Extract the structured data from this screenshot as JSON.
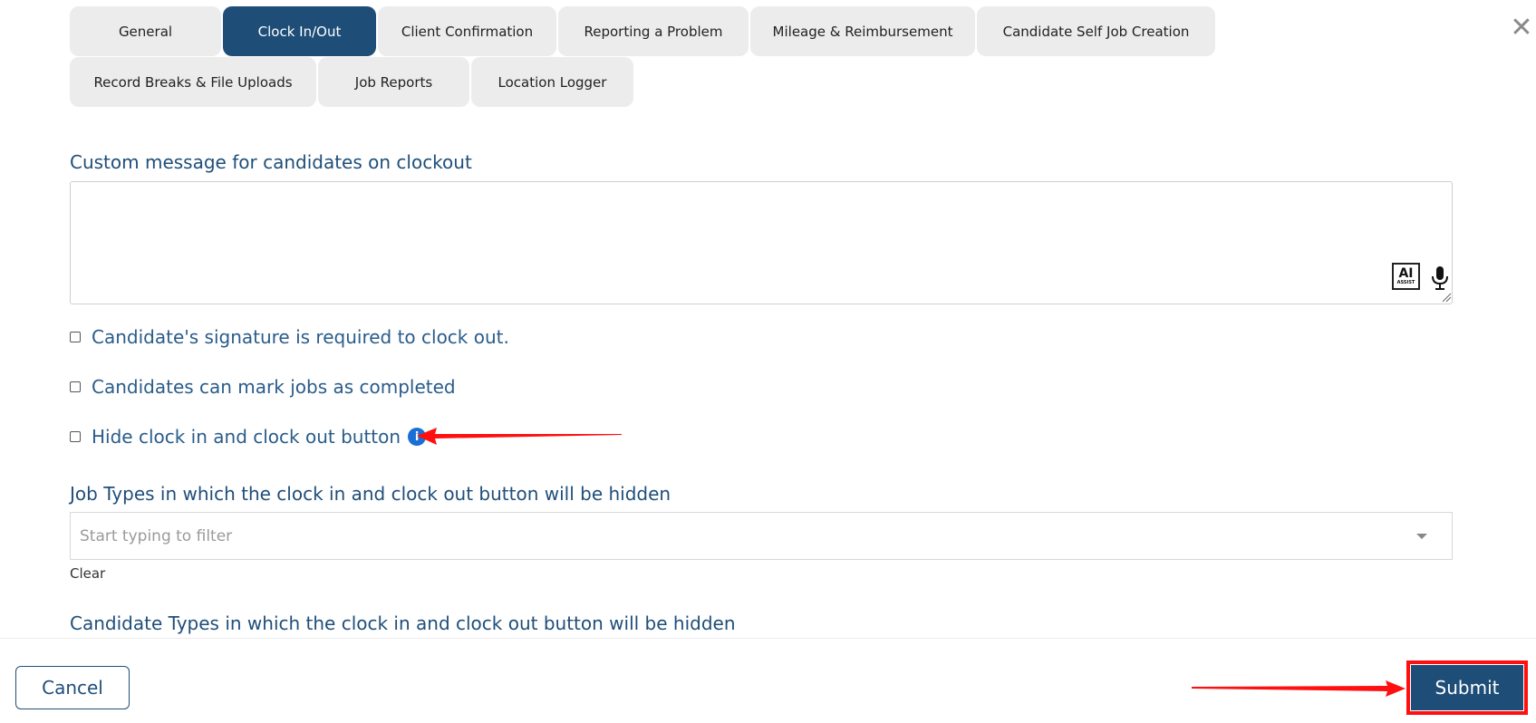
{
  "tabs": [
    {
      "label": "General",
      "active": false
    },
    {
      "label": "Clock In/Out",
      "active": true
    },
    {
      "label": "Client Confirmation",
      "active": false
    },
    {
      "label": "Reporting a Problem",
      "active": false
    },
    {
      "label": "Mileage & Reimbursement",
      "active": false
    },
    {
      "label": "Candidate Self Job Creation",
      "active": false
    },
    {
      "label": "Record Breaks & File Uploads",
      "active": false
    },
    {
      "label": "Job Reports",
      "active": false
    },
    {
      "label": "Location Logger",
      "active": false
    }
  ],
  "custom_message": {
    "label": "Custom message for candidates on clockout",
    "value": "",
    "ai_assist": {
      "big": "AI",
      "small": "ASSIST"
    }
  },
  "checkboxes": [
    {
      "label": "Candidate's signature is required to clock out.",
      "checked": false
    },
    {
      "label": "Candidates can mark jobs as completed",
      "checked": false
    },
    {
      "label": "Hide clock in and clock out button",
      "checked": false,
      "info_glyph": "i"
    }
  ],
  "job_types": {
    "label": "Job Types in which the clock in and clock out button will be hidden",
    "placeholder": "Start typing to filter",
    "clear_label": "Clear"
  },
  "candidate_types": {
    "label": "Candidate Types in which the clock in and clock out button will be hidden"
  },
  "footer": {
    "cancel_label": "Cancel",
    "submit_label": "Submit"
  },
  "colors": {
    "accent": "#1e4e78",
    "annotation": "#ff1010",
    "info": "#1a6fd6"
  },
  "icons": {
    "close": "close-icon",
    "microphone": "microphone-icon",
    "info": "info-icon",
    "dropdown": "chevron-down-icon"
  }
}
